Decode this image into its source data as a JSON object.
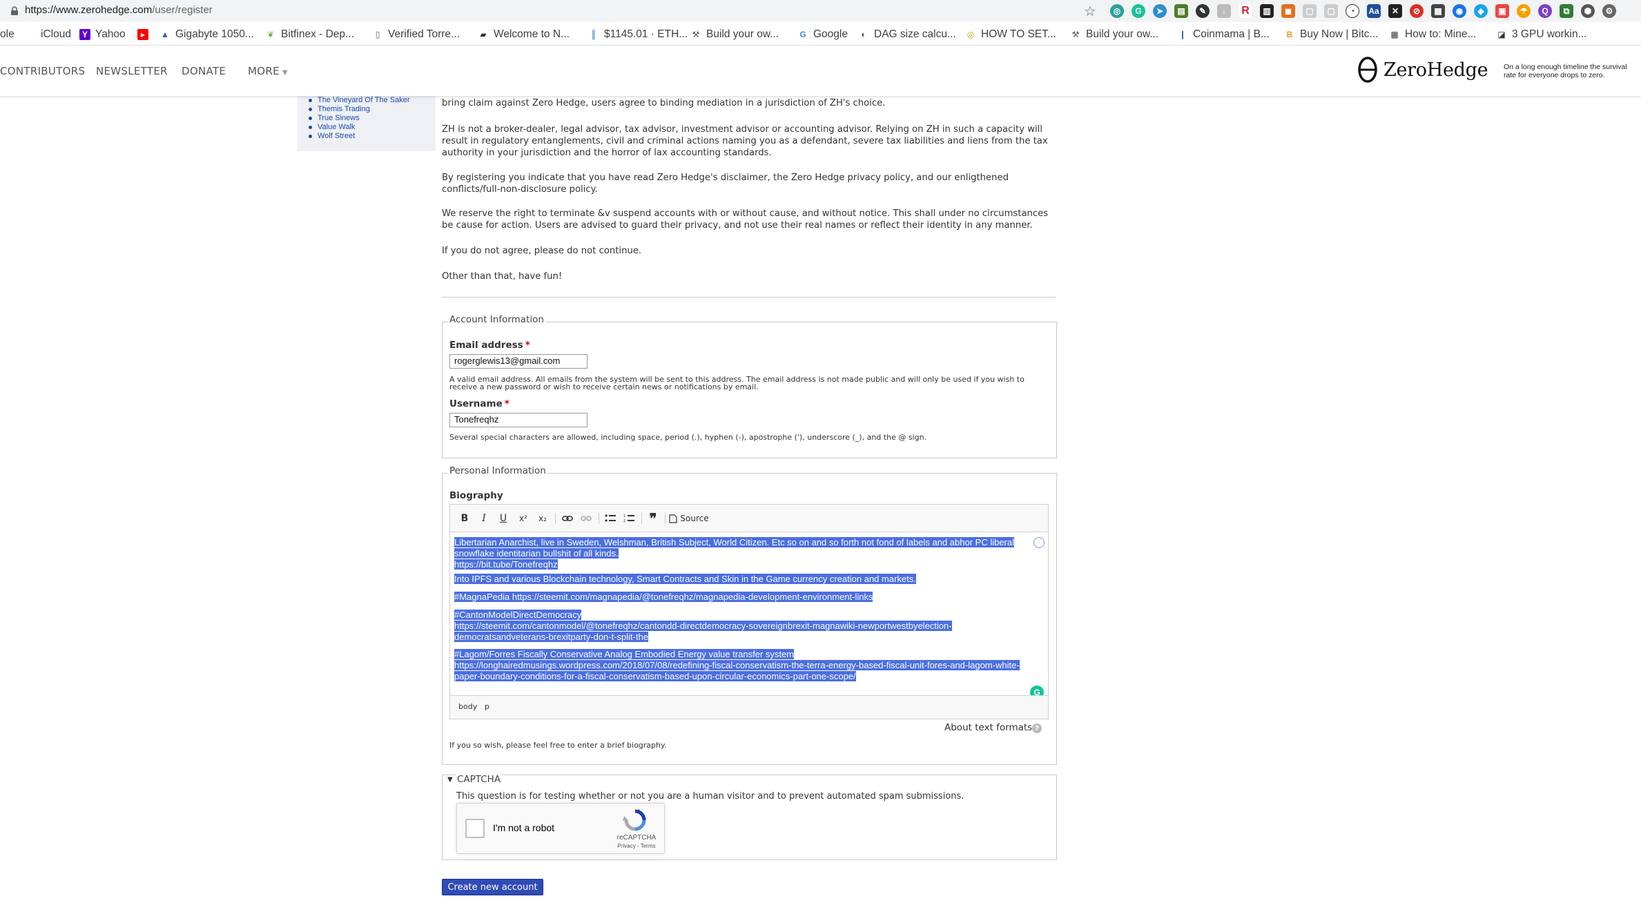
{
  "browser": {
    "url_host": "https://www.zerohedge.com",
    "url_path": "/user/register",
    "bookmarks": [
      {
        "label": "ole",
        "icon": ""
      },
      {
        "label": "iCloud",
        "icon": "apple-icon"
      },
      {
        "label": "Yahoo",
        "icon": "yahoo-icon"
      },
      {
        "label": "",
        "icon": "youtube-icon"
      },
      {
        "label": "Gigabyte 1050...",
        "icon": "gigabyte-icon"
      },
      {
        "label": "Bitfinex - Dep...",
        "icon": "bitfinex-icon"
      },
      {
        "label": "Verified Torre...",
        "icon": "page-icon"
      },
      {
        "label": "Welcome to N...",
        "icon": "car-icon"
      },
      {
        "label": "$1145.01 · ETH...",
        "icon": "eth-icon"
      },
      {
        "label": "Build your ow...",
        "icon": "miner-icon"
      },
      {
        "label": "Google",
        "icon": "google-icon"
      },
      {
        "label": "DAG size calcu...",
        "icon": "globe-icon"
      },
      {
        "label": "HOW TO SET...",
        "icon": "coin-icon"
      },
      {
        "label": "Build your ow...",
        "icon": "miner-icon"
      },
      {
        "label": "Coinmama | B...",
        "icon": "coinmama-icon"
      },
      {
        "label": "Buy Now | Bitc...",
        "icon": "bitcoin-icon"
      },
      {
        "label": "How to: Mine...",
        "icon": "mine-icon"
      },
      {
        "label": "3 GPU workin...",
        "icon": "gpu-icon"
      }
    ]
  },
  "header": {
    "nav": [
      "CONTRIBUTORS",
      "NEWSLETTER",
      "DONATE",
      "MORE"
    ],
    "logo_text": "ZeroHedge",
    "tagline": "On a long enough timeline the survival rate for everyone drops to zero."
  },
  "sidebar": {
    "links": [
      "The Vineyard Of The Saker",
      "Themis Trading",
      "True Sinews",
      "Value Walk",
      "Wolf Street"
    ]
  },
  "terms": {
    "p0": "bring claim against Zero Hedge, users agree to binding mediation in a jurisdiction of ZH's choice.",
    "p1": "ZH is not a broker-dealer, legal advisor, tax advisor, investment advisor or accounting advisor. Relying on ZH in such a capacity will result in regulatory entanglements, civil and criminal actions naming you as a defendant, severe tax liabilities and liens from the tax authority in your jurisdiction and the horror of lax accounting standards.",
    "p2": "By registering you indicate that you have read Zero Hedge's disclaimer, the Zero Hedge privacy policy, and our enligthened conflicts/full-non-disclosure policy.",
    "p3": "We reserve the right to terminate &v suspend accounts with or without cause, and without notice. This shall under no circumstances be cause for action. Users are advised to guard their privacy, and not use their real names or reflect their identity in any manner.",
    "p4": "If you do not agree, please do not continue.",
    "p5": "Other than that, have fun!"
  },
  "account": {
    "legend": "Account Information",
    "email_label": "Email address",
    "email_value": "rogerglewis13@gmail.com",
    "email_desc": "A valid email address. All emails from the system will be sent to this address. The email address is not made public and will only be used if you wish to receive a new password or wish to receive certain news or notifications by email.",
    "username_label": "Username",
    "username_value": "Tonefreqhz",
    "username_desc": "Several special characters are allowed, including space, period (.), hyphen (-), apostrophe ('), underscore (_), and the @ sign."
  },
  "personal": {
    "legend": "Personal Information",
    "bio_label": "Biography",
    "toolbar": {
      "bold": "B",
      "italic": "I",
      "underline": "U",
      "superscript": "x²",
      "subscript": "x₂",
      "source": "Source"
    },
    "bio": {
      "l1": "Libertarian Anarchist, live in Sweden, Welshman, British Subject, World Citizen. Etc so on and so forth not fond of labels and abhor PC liberal",
      "l2": "snowflake identitarian bullshit of all kinds.",
      "l3": "https://bit.tube/Tonefreqhz",
      "l4": "Into IPFS and various Blockchain technology, Smart Contracts and Skin in the Game currency creation and markets.",
      "l5": "#MagnaPedia https://steemit.com/magnapedia/@tonefreqhz/magnapedia-development-environment-links",
      "l6": "#CantonModelDirectDemocracy",
      "l7": "https://steemit.com/cantonmodel/@tonefreqhz/cantondd-directdemocracy-sovereignbrexit-magnawiki-newportwestbyelection-",
      "l8": "democratsandveterans-brexitparty-don-t-split-the",
      "l9": "#Lagom/Forres  Fiscally Conservative Analog Embodied Energy value transfer system",
      "l10": "https://longhairedmusings.wordpress.com/2018/07/08/redefining-fiscal-conservatism-the-terra-energy-based-fiscal-unit-fores-and-lagom-white-",
      "l11": "paper-boundary-conditions-for-a-fiscal-conservatism-based-upon-circular-economics-part-one-scope/"
    },
    "path_body": "body",
    "path_p": "p",
    "about_formats": "About text formats",
    "help": "?",
    "bio_desc": "If you so wish, please feel free to enter a brief biography."
  },
  "captcha": {
    "legend": "CAPTCHA",
    "desc": "This question is for testing whether or not you are a human visitor and to prevent automated spam submissions.",
    "checkbox_label": "I'm not a robot",
    "brand": "reCAPTCHA",
    "terms": "Privacy - Terms"
  },
  "submit_label": "Create new account",
  "colors": {
    "selection": "#4b6fe0",
    "button": "#2f4bb5",
    "link": "#1a4aa8",
    "grammarly": "#15c39a"
  }
}
